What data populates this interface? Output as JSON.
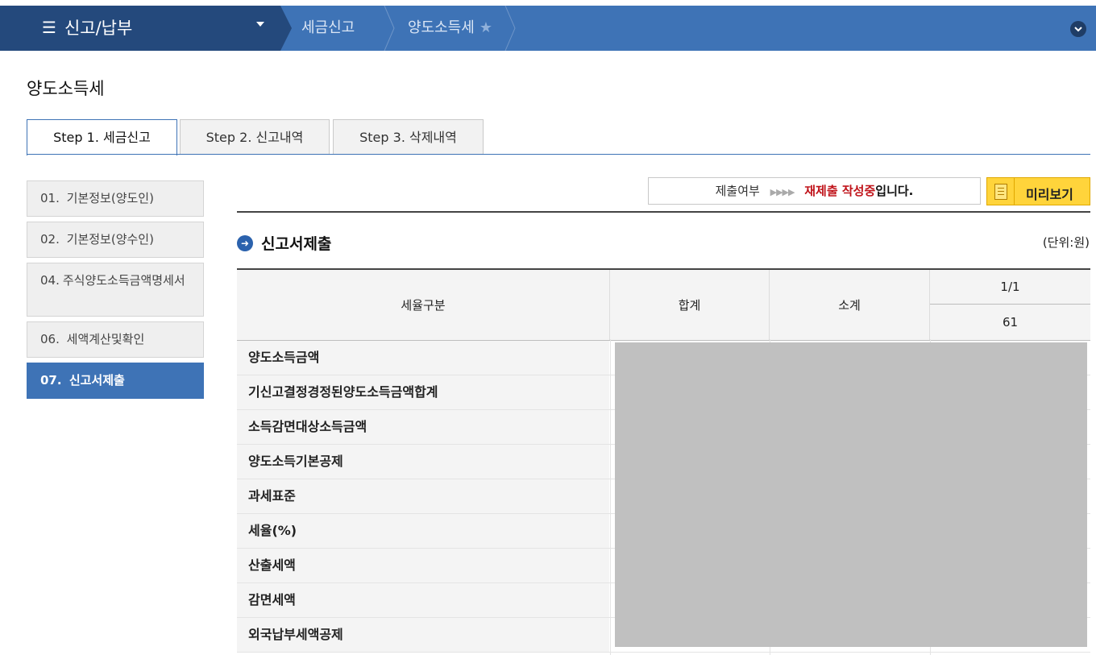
{
  "nav": {
    "menu_label": "신고/납부",
    "breadcrumbs": [
      "세금신고",
      "양도소득세"
    ],
    "favorite_icon": "star-icon",
    "colors": {
      "bar": "#3e73b6",
      "bar_dark": "#24497c"
    }
  },
  "page": {
    "title": "양도소득세"
  },
  "tabs": [
    {
      "label": "Step 1. 세금신고",
      "active": true
    },
    {
      "label": "Step 2. 신고내역",
      "active": false
    },
    {
      "label": "Step 3. 삭제내역",
      "active": false
    }
  ],
  "sidebar": {
    "items": [
      {
        "num": "01.",
        "label": "기본정보(양도인)",
        "active": false
      },
      {
        "num": "02.",
        "label": "기본정보(양수인)",
        "active": false
      },
      {
        "num": "04.",
        "label": "주식양도소득금액명세서",
        "active": false
      },
      {
        "num": "06.",
        "label": "세액계산및확인",
        "active": false
      },
      {
        "num": "07.",
        "label": "신고서제출",
        "active": true
      }
    ]
  },
  "status": {
    "label": "제출여부",
    "arrows": "▶▶▶▶",
    "state_highlight": "재제출 작성중",
    "state_tail": "입니다.",
    "highlight_color": "#c0141b"
  },
  "preview_button": {
    "label": "미리보기"
  },
  "section": {
    "title": "신고서제출",
    "unit": "(단위:원)"
  },
  "table": {
    "headers": {
      "category": "세율구분",
      "total": "합계",
      "subtotal": "소계",
      "page": "1/1",
      "code": "61"
    },
    "rows": [
      "양도소득금액",
      "기신고결정경정된양도소득금액합계",
      "소득감면대상소득금액",
      "양도소득기본공제",
      "과세표준",
      "세율(%)",
      "산출세액",
      "감면세액",
      "외국납부세액공제"
    ]
  }
}
